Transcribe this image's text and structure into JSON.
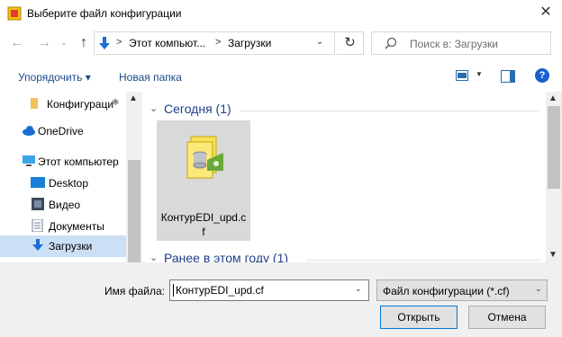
{
  "window": {
    "title": "Выберите файл конфигурации",
    "close_glyph": "✕"
  },
  "navigation": {
    "back_glyph": "←",
    "forward_glyph": "→",
    "recent_glyph": "⌄",
    "up_glyph": "↑",
    "breadcrumb": [
      "Этот компьют...",
      "Загрузки"
    ],
    "breadcrumb_separator": ">",
    "dropdown_glyph": "⌄",
    "refresh_glyph": "↻",
    "search_placeholder": "Поиск в: Загрузки"
  },
  "toolbar": {
    "organize_label": "Упорядочить ▾",
    "new_folder_label": "Новая папка",
    "help_glyph": "?"
  },
  "sidebar": {
    "items": [
      {
        "label": "Конфигураци",
        "icon": "folder-icon"
      },
      {
        "label": "OneDrive",
        "icon": "cloud-icon"
      },
      {
        "label": "Этот компьютер",
        "icon": "computer-icon"
      },
      {
        "label": "Desktop",
        "icon": "desktop-icon"
      },
      {
        "label": "Видео",
        "icon": "video-icon"
      },
      {
        "label": "Документы",
        "icon": "documents-icon"
      },
      {
        "label": "Загрузки",
        "icon": "downloads-icon"
      }
    ],
    "pin_glyph": "✱"
  },
  "content": {
    "groups": [
      {
        "label": "Сегодня (1)"
      },
      {
        "label": "Ранее в этом году (1)"
      }
    ],
    "group_chevron": "⌄",
    "files": [
      {
        "name": "КонтурEDI_upd.cf"
      }
    ]
  },
  "footer": {
    "filename_label": "Имя файла:",
    "filename_value": "КонтурEDI_upd.cf",
    "filetype_value": "Файл конфигурации (*.cf)",
    "open_label": "Открыть",
    "cancel_label": "Отмена",
    "dropdown_glyph": "⌄"
  },
  "colors": {
    "accent": "#0078d7",
    "link": "#1a4a8a",
    "group_header": "#1e3f8a",
    "selection": "#cce0f5",
    "tile_selected": "#d9d9d9"
  }
}
